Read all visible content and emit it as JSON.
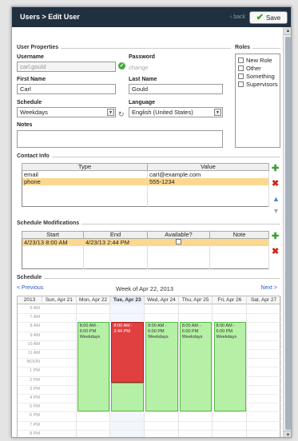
{
  "header": {
    "title": "Users > Edit User",
    "back_label": "‹ back",
    "save_label": "Save"
  },
  "user_properties": {
    "section_title": "User Properties",
    "username_label": "Username",
    "username_value": "carl.gould",
    "password_label": "Password",
    "password_link": "change",
    "first_name_label": "First Name",
    "first_name_value": "Carl",
    "last_name_label": "Last Name",
    "last_name_value": "Gould",
    "schedule_label": "Schedule",
    "schedule_value": "Weekdays",
    "language_label": "Language",
    "language_value": "English (United States)",
    "notes_label": "Notes",
    "notes_value": ""
  },
  "roles": {
    "section_title": "Roles",
    "items": [
      {
        "label": "New Role",
        "checked": false
      },
      {
        "label": "Other",
        "checked": false
      },
      {
        "label": "Something",
        "checked": false
      },
      {
        "label": "Supervisors",
        "checked": false
      }
    ]
  },
  "contact_info": {
    "section_title": "Contact Info",
    "columns": [
      "Type",
      "Value"
    ],
    "rows": [
      {
        "type": "email",
        "value": "carl@example.com",
        "selected": false
      },
      {
        "type": "phone",
        "value": "555-1234",
        "selected": true
      }
    ]
  },
  "schedule_mods": {
    "section_title": "Schedule Modifications",
    "columns": [
      "Start",
      "End",
      "Available?",
      "Note"
    ],
    "rows": [
      {
        "start": "4/23/13 8:00 AM",
        "end": "4/23/13 2:44 PM",
        "available": false,
        "note": "",
        "selected": true
      }
    ]
  },
  "calendar": {
    "section_title": "Schedule",
    "prev_label": "< Previous",
    "week_label": "Week of Apr 22, 2013",
    "next_label": "Next >",
    "year_label": "2013",
    "days": [
      "Sun, Apr 21",
      "Mon, Apr 22",
      "Tue, Apr 23",
      "Wed, Apr 24",
      "Thu, Apr 25",
      "Fri, Apr 26",
      "Sat, Apr 27"
    ],
    "hours": [
      "6 AM",
      "7 AM",
      "8 AM",
      "9 AM",
      "10 AM",
      "11 AM",
      "NOON",
      "1 PM",
      "2 PM",
      "3 PM",
      "4 PM",
      "5 PM",
      "6 PM",
      "7 PM",
      "8 PM"
    ],
    "events": [
      {
        "day": 1,
        "start": 8,
        "end": 18,
        "color": "green",
        "text": [
          "8:00 AM -",
          "6:00 PM",
          "Weekdays"
        ]
      },
      {
        "day": 2,
        "start": 8,
        "end": 14.73,
        "color": "red",
        "text": [
          "8:00 AM -",
          "2:44 PM"
        ]
      },
      {
        "day": 2,
        "start": 14.73,
        "end": 18,
        "color": "green",
        "text": []
      },
      {
        "day": 3,
        "start": 8,
        "end": 18,
        "color": "green",
        "text": [
          "8:00 AM -",
          "6:00 PM",
          "Weekdays"
        ]
      },
      {
        "day": 4,
        "start": 8,
        "end": 18,
        "color": "green",
        "text": [
          "8:00 AM -",
          "6:00 PM",
          "Weekdays"
        ]
      },
      {
        "day": 5,
        "start": 8,
        "end": 18,
        "color": "green",
        "text": [
          "8:00 AM -",
          "6:00 PM",
          "Weekdays"
        ]
      }
    ]
  },
  "colors": {
    "header_bg": "#20303f",
    "selected_row": "#fbd790",
    "event_green": "#b6f0a6",
    "event_red": "#e14040",
    "link": "#2b59c3"
  }
}
